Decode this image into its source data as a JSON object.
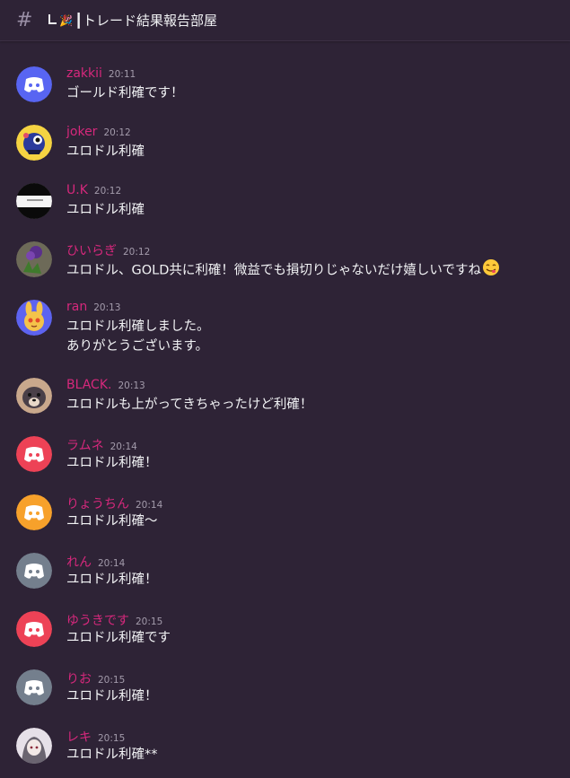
{
  "header": {
    "hash": "#",
    "channel_prefix": "┗🎉",
    "channel_name": "┃トレード結果報告部屋"
  },
  "colors": {
    "background": "#2e2336",
    "username": "#d6287c",
    "text": "#f2f3f5",
    "timestamp": "#a39bab"
  },
  "messages": [
    {
      "username": "zakkii",
      "time": "20:11",
      "lines": [
        "ゴールド利確です！"
      ],
      "avatar": "discord-blurple"
    },
    {
      "username": "joker",
      "time": "20:12",
      "lines": [
        "ユロドル利確"
      ],
      "avatar": "custom-character"
    },
    {
      "username": "U.K",
      "time": "20:12",
      "lines": [
        "ユロドル利確"
      ],
      "avatar": "custom-photo"
    },
    {
      "username": "ひいらぎ",
      "time": "20:12",
      "lines": [
        "ユロドル、GOLD共に利確！微益でも損切りじゃないだけ嬉しいですね"
      ],
      "emoji": "yum-face",
      "avatar": "custom-flower"
    },
    {
      "username": "ran",
      "time": "20:13",
      "lines": [
        "ユロドル利確しました。",
        "ありがとうございます。"
      ],
      "avatar": "custom-rabbit"
    },
    {
      "username": "BLACK.",
      "time": "20:13",
      "lines": [
        "ユロドルも上がってきちゃったけど利確！"
      ],
      "avatar": "custom-dog"
    },
    {
      "username": "ラムネ",
      "time": "20:14",
      "lines": [
        "ユロドル利確！"
      ],
      "avatar": "discord-red"
    },
    {
      "username": "りょうちん",
      "time": "20:14",
      "lines": [
        "ユロドル利確～"
      ],
      "avatar": "discord-orange"
    },
    {
      "username": "れん",
      "time": "20:14",
      "lines": [
        "ユロドル利確！"
      ],
      "avatar": "discord-grey"
    },
    {
      "username": "ゆうきです",
      "time": "20:15",
      "lines": [
        "ユロドル利確です"
      ],
      "avatar": "discord-red"
    },
    {
      "username": "りお",
      "time": "20:15",
      "lines": [
        "ユロドル利確！"
      ],
      "avatar": "discord-grey"
    },
    {
      "username": "レキ",
      "time": "20:15",
      "lines": [
        "ユロドル利確**"
      ],
      "avatar": "custom-anime"
    }
  ]
}
